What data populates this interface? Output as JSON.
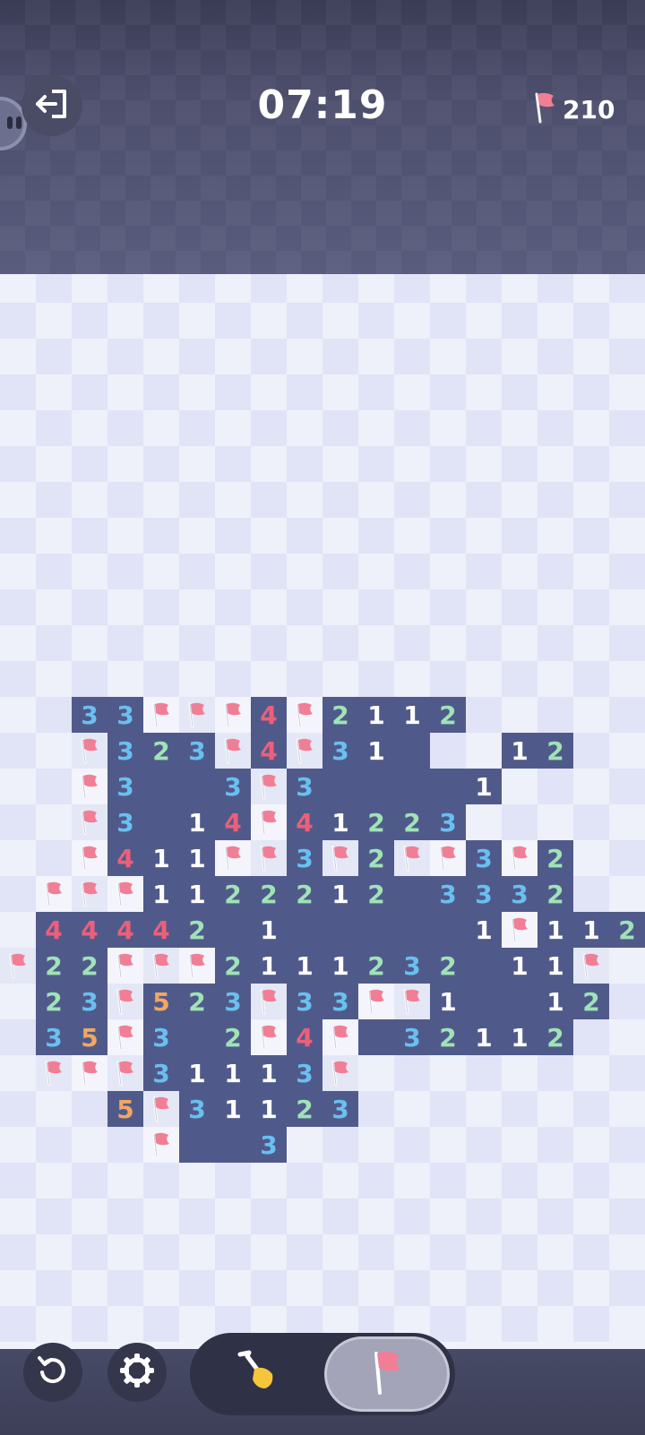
{
  "header": {
    "timer": "07:19",
    "flags_remaining": "210",
    "icons": {
      "exit": "exit-icon",
      "flag_counter": "flag-icon",
      "avatar": "avatar-icon"
    }
  },
  "colors": {
    "revealed_bg": "#505a8a",
    "num1": "#ffffff",
    "num2": "#9fe3b7",
    "num3": "#69c0f0",
    "num4": "#ec5f7a",
    "num5": "#f2a761",
    "flag": "#f07f96"
  },
  "board": {
    "rows": [
      "..................",
      "..................",
      "..................",
      "..................",
      "..................",
      "..................",
      "..................",
      "..................",
      "..................",
      "..................",
      "..................",
      "..................",
      "..33FFF4F2112.....",
      "..F323F4F31 ..12..",
      "..F3  3F3    1....",
      "..F3 14F41223.....",
      "..F411FF3F2FF3F2..",
      ".FFF1122212 3332..",
      ".44442 1     1F112",
      "F22FFF2111232 11F.",
      ".23F523F33FF1  12.",
      ".35F3 2F4F 32112..",
      ".FFF31113F........",
      "...5F31123........",
      "....F  3..........",
      "..................",
      "..................",
      "..................",
      "..................",
      ".................."
    ]
  },
  "controls": {
    "undo": "undo-icon",
    "settings": "gear-icon",
    "dig_mode": "shovel-icon",
    "flag_mode": "flag-icon",
    "active_mode": "flag"
  }
}
